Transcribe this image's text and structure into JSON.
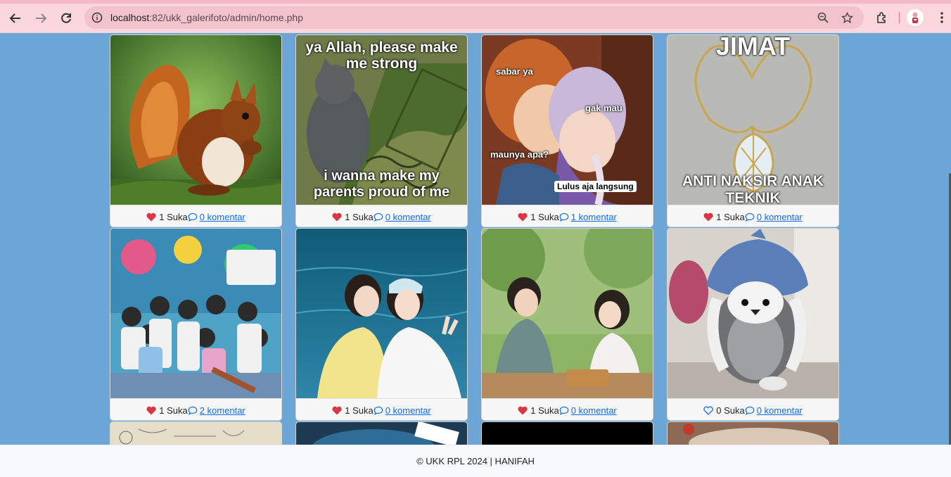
{
  "browser": {
    "url_host": "localhost",
    "url_rest": ":82/ukk_galerifoto/admin/home.php"
  },
  "cards": [
    {
      "likes": "1 Suka",
      "comments": " 0 komentar",
      "liked": true
    },
    {
      "likes": "1 Suka",
      "comments": " 0 komentar",
      "liked": true,
      "text_top": "ya Allah, please make me strong",
      "text_bottom": "i wanna make my parents proud of me"
    },
    {
      "likes": "1 Suka",
      "comments": " 1 komentar",
      "liked": true,
      "text_a": "sabar ya",
      "text_b": "gak mau",
      "text_c": "maunya apa?",
      "text_d": "Lulus aja langsung"
    },
    {
      "likes": "1 Suka",
      "comments": " 0 komentar",
      "liked": true,
      "text_top": "JIMAT",
      "text_bottom": "ANTI NAKSIR ANAK TEKNIK"
    },
    {
      "likes": "1 Suka",
      "comments": " 2 komentar",
      "liked": true
    },
    {
      "likes": "1 Suka",
      "comments": " 0 komentar",
      "liked": true
    },
    {
      "likes": "1 Suka",
      "comments": " 0 komentar",
      "liked": true
    },
    {
      "likes": "0 Suka",
      "comments": " 0 komentar",
      "liked": false
    }
  ],
  "footer": {
    "text": "© UKK RPL 2024 | HANIFAH"
  },
  "colors": {
    "page_bg": "#6ca6d6",
    "heart_red": "#dc3545",
    "link_blue": "#0d6efd",
    "chrome_pink": "#fcd6dd"
  }
}
